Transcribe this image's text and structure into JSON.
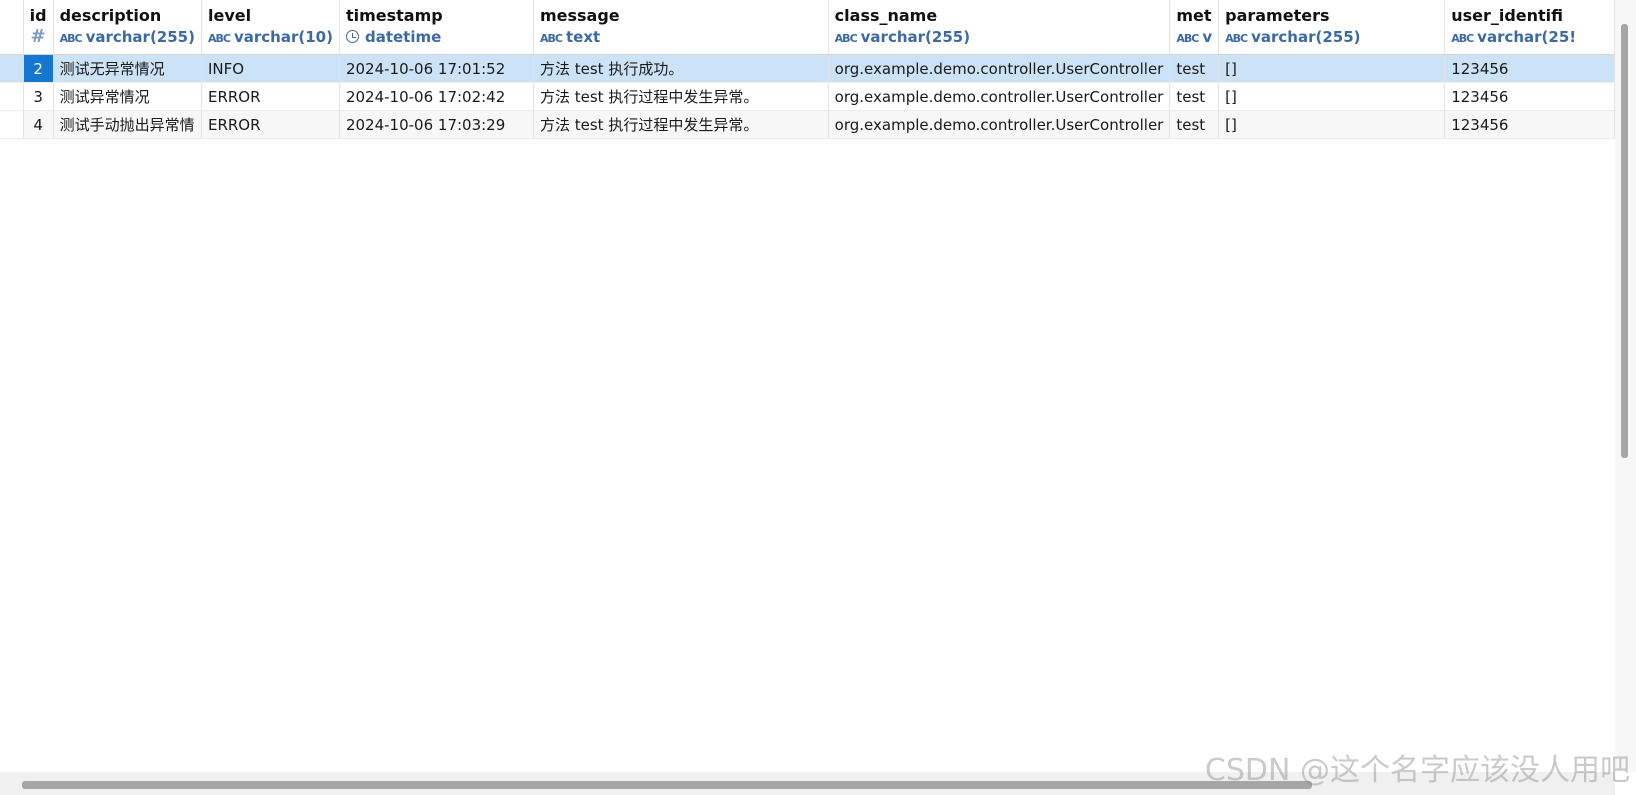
{
  "columns": [
    {
      "name": "id",
      "type": "#"
    },
    {
      "name": "description",
      "type": "varchar(255)"
    },
    {
      "name": "level",
      "type": "varchar(10)"
    },
    {
      "name": "timestamp",
      "type": "datetime"
    },
    {
      "name": "message",
      "type": "text"
    },
    {
      "name": "class_name",
      "type": "varchar(255)"
    },
    {
      "name": "met",
      "type": "v"
    },
    {
      "name": "parameters",
      "type": "varchar(255)"
    },
    {
      "name": "user_identifi",
      "type": "varchar(25!"
    }
  ],
  "type_icon_text": "ABC",
  "rows": [
    {
      "id": "2",
      "description": "测试无异常情况",
      "level": "INFO",
      "timestamp": "2024-10-06 17:01:52",
      "message": "方法 test 执行成功。",
      "class_name": "org.example.demo.controller.UserController",
      "method": "test",
      "parameters": "[]",
      "user_identifier": "123456"
    },
    {
      "id": "3",
      "description": "测试异常情况",
      "level": "ERROR",
      "timestamp": "2024-10-06 17:02:42",
      "message": "方法 test 执行过程中发生异常。",
      "class_name": "org.example.demo.controller.UserController",
      "method": "test",
      "parameters": "[]",
      "user_identifier": "123456"
    },
    {
      "id": "4",
      "description": "测试手动抛出异常情",
      "level": "ERROR",
      "timestamp": "2024-10-06 17:03:29",
      "message": "方法 test 执行过程中发生异常。",
      "class_name": "org.example.demo.controller.UserController",
      "method": "test",
      "parameters": "[]",
      "user_identifier": "123456"
    }
  ],
  "watermark": "CSDN @这个名字应该没人用吧",
  "colors": {
    "selected_row": "#cce3f7",
    "selected_id": "#1577d2",
    "type_text": "#3b6aa6",
    "id_header": "#d9e8f8"
  }
}
